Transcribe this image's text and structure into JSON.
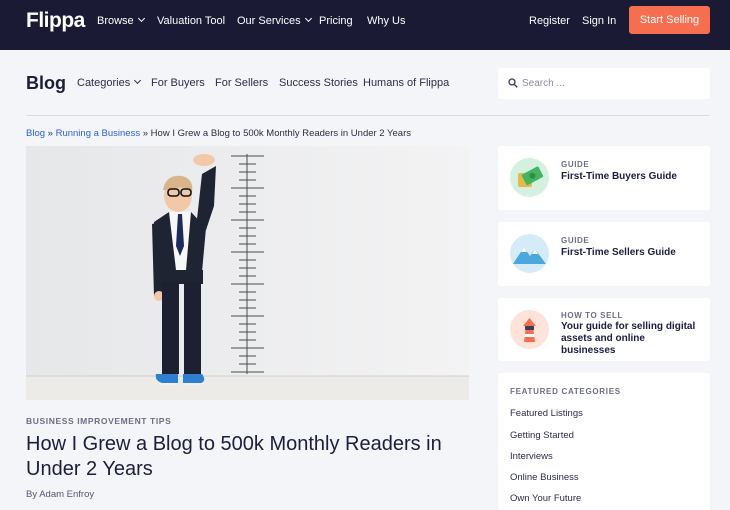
{
  "topnav": {
    "logo": "Flippa",
    "items": [
      "Browse",
      "Valuation Tool",
      "Our Services",
      "Pricing",
      "Why Us"
    ],
    "register": "Register",
    "sign_in": "Sign In",
    "cta": "Start Selling"
  },
  "blognav": {
    "title": "Blog",
    "items": [
      "Categories",
      "For Buyers",
      "For Sellers",
      "Success Stories",
      "Humans of Flippa"
    ],
    "search_placeholder": "Search ..."
  },
  "breadcrumb": {
    "items": [
      "Blog",
      "Running a Business"
    ],
    "separator": "»",
    "current": "How I Grew a Blog to 500k Monthly Readers in Under 2 Years"
  },
  "article": {
    "category": "BUSINESS IMPROVEMENT TIPS",
    "title": "How I Grew a Blog to 500k Monthly Readers in Under 2 Years",
    "author": "By Adam Enfroy"
  },
  "sidebar": {
    "cards": [
      {
        "kicker": "GUIDE",
        "title": "First-Time Buyers Guide",
        "icon": "money-icon"
      },
      {
        "kicker": "GUIDE",
        "title": "First-Time Sellers Guide",
        "icon": "mountain-icon"
      },
      {
        "kicker": "HOW TO SELL",
        "title": "Your guide for selling digital assets and online businesses",
        "icon": "lighthouse-icon"
      }
    ],
    "featured": {
      "heading": "FEATURED CATEGORIES",
      "links": [
        "Featured Listings",
        "Getting Started",
        "Interviews",
        "Online Business",
        "Own Your Future"
      ]
    }
  },
  "colors": {
    "nav_bg": "#1b1a34",
    "cta": "#f46e4f",
    "link": "#2b5fd9",
    "page_bg": "#f4f5f9"
  }
}
